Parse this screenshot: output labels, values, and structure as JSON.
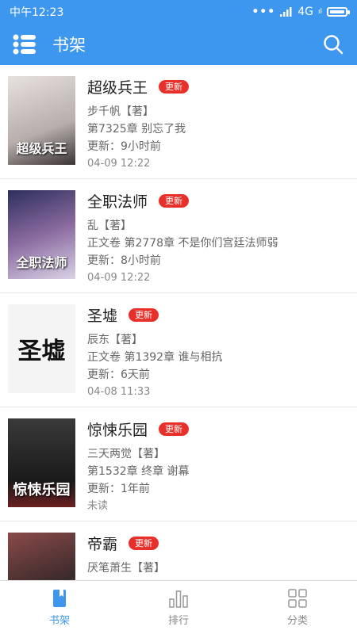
{
  "status_bar": {
    "time": "中午12:23",
    "dots": "•••",
    "network": "4G",
    "network_sub": "ıl"
  },
  "app_bar": {
    "title": "书架"
  },
  "books": [
    {
      "title": "超级兵王",
      "badge": "更新",
      "author": "步千帆【著】",
      "chapter": "第7325章 别忘了我",
      "updated": "更新：9小时前",
      "date": "04-09 12:22",
      "cover_text": "超级兵王",
      "cover_color": "#c9c2c0"
    },
    {
      "title": "全职法师",
      "badge": "更新",
      "author": "乱【著】",
      "chapter": "正文卷 第2778章 不是你们宫廷法师弱",
      "updated": "更新：8小时前",
      "date": "04-09 12:22",
      "cover_text": "全职法师",
      "cover_color": "#5b5f8d"
    },
    {
      "title": "圣墟",
      "badge": "更新",
      "author": "辰东【著】",
      "chapter": "正文卷 第1392章 谁与相抗",
      "updated": "更新：6天前",
      "date": "04-08 11:33",
      "cover_text": "圣墟",
      "cover_color": "#f2f2f2"
    },
    {
      "title": "惊悚乐园",
      "badge": "更新",
      "author": "三天两觉【著】",
      "chapter": "第1532章 终章 谢幕",
      "updated": "更新：1年前",
      "date": "未读",
      "cover_text": "惊悚乐园",
      "cover_color": "#2b2b2b"
    },
    {
      "title": "帝霸",
      "badge": "更新",
      "author": "厌笔萧生【著】",
      "chapter": "",
      "updated": "",
      "date": "",
      "cover_text": "",
      "cover_color": "#6b3b3b"
    }
  ],
  "bottom_nav": [
    {
      "label": "书架",
      "icon": "bookshelf-icon",
      "active": true
    },
    {
      "label": "排行",
      "icon": "bar-chart-icon",
      "active": false
    },
    {
      "label": "分类",
      "icon": "grid-icon",
      "active": false
    }
  ],
  "colors": {
    "primary": "#3d97ee",
    "badge": "#e8302a"
  }
}
